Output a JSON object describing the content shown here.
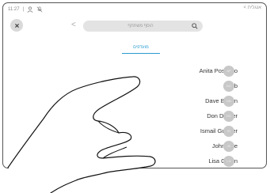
{
  "status_bar": {
    "time": "11:27",
    "separator": "|",
    "icons": [
      "person-icon",
      "microphone-muted-icon"
    ]
  },
  "header": {
    "back_label": "<",
    "lang_link": "< אנגלית",
    "close_icon": "close-icon",
    "search": {
      "placeholder": "הוסף משתתף",
      "icon": "search-icon"
    }
  },
  "tabs": [
    {
      "label": "מועדפים",
      "active": true
    }
  ],
  "contacts": [
    {
      "name": "Anita Poscotto",
      "initials": "AP"
    },
    {
      "name": "Bob",
      "initials": "BO"
    },
    {
      "name": "Dave Brown",
      "initials": "DB"
    },
    {
      "name": "Don Draper",
      "initials": "DD"
    },
    {
      "name": "Ismail Gulliver",
      "initials": "IG"
    },
    {
      "name": "John Doe",
      "initials": "JD"
    },
    {
      "name": "Lisa Green",
      "initials": "LG"
    }
  ],
  "colors": {
    "accent": "#2a9cd1",
    "avatar_bg": "#c8c8c8",
    "search_bg": "#e3e3e3"
  }
}
